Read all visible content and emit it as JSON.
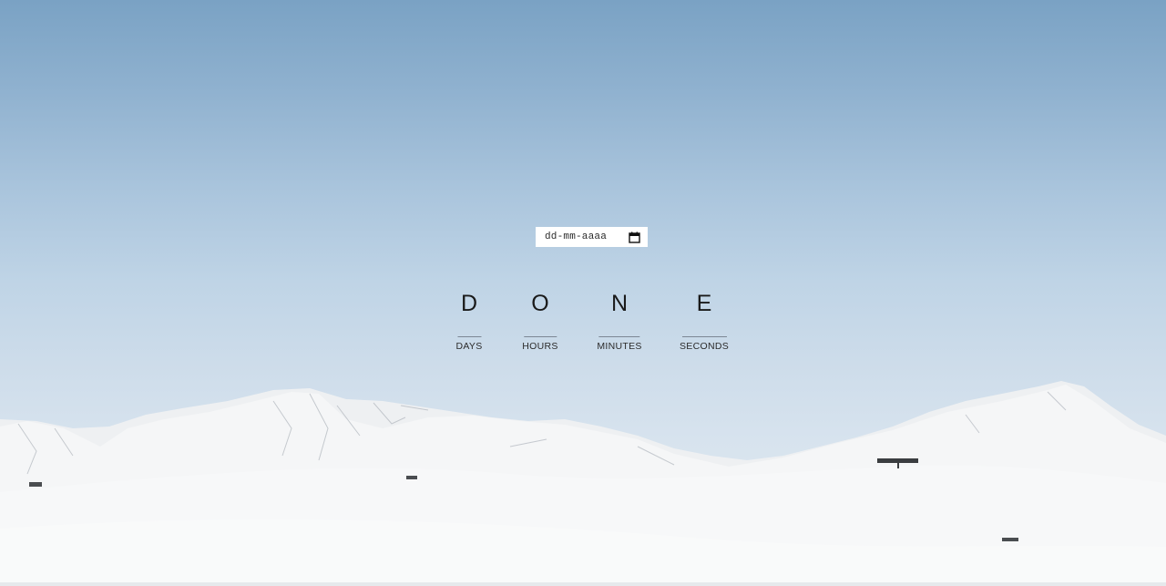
{
  "date_input": {
    "placeholder": "dd-mm-aaaa",
    "icon": "calendar-icon"
  },
  "countdown": {
    "units": [
      {
        "value": "D",
        "label": "DAYS"
      },
      {
        "value": "O",
        "label": "HOURS"
      },
      {
        "value": "N",
        "label": "MINUTES"
      },
      {
        "value": "E",
        "label": "SECONDS"
      }
    ]
  },
  "colors": {
    "sky_top": "#7aa2c4",
    "sky_bottom": "#e4ebf2",
    "snow": "#f4f5f6",
    "text": "#1a1a1a"
  }
}
